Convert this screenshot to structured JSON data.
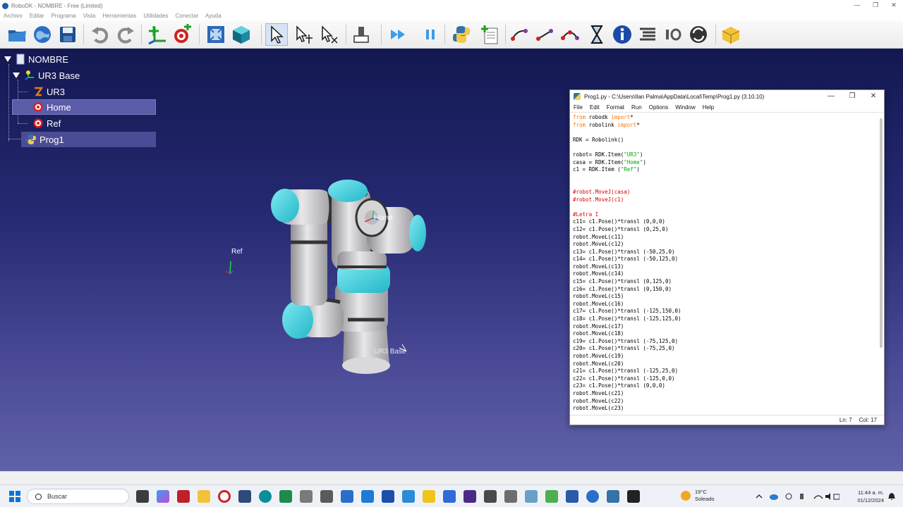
{
  "window": {
    "title": "RoboDK - NOMBRE - Free (Limited)",
    "controls": [
      "—",
      "❐",
      "✕"
    ]
  },
  "menu": [
    "Archivo",
    "Editar",
    "Programa",
    "Vista",
    "Herramientas",
    "Utilidades",
    "Conectar",
    "Ayuda"
  ],
  "toolbar": {
    "icons": [
      "open-station-icon",
      "online-library-icon",
      "save-icon",
      "undo-icon",
      "redo-icon",
      "add-reference-frame-icon",
      "add-target-icon",
      "fit-all-icon",
      "view-iso-icon",
      "select-icon",
      "move-reference-icon",
      "move-tool-icon",
      "move-robot-icon",
      "play-icon",
      "pause-icon",
      "python-icon",
      "add-program-icon",
      "movej-icon",
      "movel-icon",
      "movec-icon",
      "pause-instruction-icon",
      "info-icon",
      "program-list-icon",
      "io-icon",
      "program-call-icon",
      "package-icon"
    ]
  },
  "tree": {
    "station": "NOMBRE",
    "base": "UR3 Base",
    "robot": "UR3",
    "target1": "Home",
    "target2": "Ref",
    "program": "Prog1"
  },
  "scene": {
    "ref_label": "Ref",
    "home_label": "Home",
    "base_label": "UR3 Base",
    "robot_colors": {
      "joint_cap": "#47d6e2",
      "body": "#c9c9cb",
      "band": "#3a3a3a"
    }
  },
  "editor": {
    "title": "Prog1.py - C:\\Users\\Ilan Palma\\AppData\\Local\\Temp\\Prog1.py (3.10.10)",
    "menu": [
      "File",
      "Edit",
      "Format",
      "Run",
      "Options",
      "Window",
      "Help"
    ],
    "status_line": "Ln: 7",
    "status_col": "Col: 17",
    "code": [
      "from robodk import*",
      "from robolink import*",
      "",
      "RDK = Robolink()",
      "",
      "robot= RDK.Item(\"UR3\")",
      "casa = RDK.Item(\"Home\")",
      "c1 = RDK.Item (\"Ref\")",
      "",
      "",
      "#robot.MoveJ(casa)",
      "#robot.MoveJ(c1)",
      "",
      "#Letra I",
      "c11= c1.Pose()*transl (0,0,0)",
      "c12= c1.Pose()*transl (0,25,0)",
      "robot.MoveL(c11)",
      "robot.MoveL(c12)",
      "c13= c1.Pose()*transl (-50,25,0)",
      "c14= c1.Pose()*transl (-50,125,0)",
      "robot.MoveL(c13)",
      "robot.MoveL(c14)",
      "c15= c1.Pose()*transl (0,125,0)",
      "c16= c1.Pose()*transl (0,150,0)",
      "robot.MoveL(c15)",
      "robot.MoveL(c16)",
      "c17= c1.Pose()*transl (-125,150,0)",
      "c18= c1.Pose()*transl (-125,125,0)",
      "robot.MoveL(c17)",
      "robot.MoveL(c18)",
      "c19= c1.Pose()*transl (-75,125,0)",
      "c20= c1.Pose()*transl (-75,25,0)",
      "robot.MoveL(c19)",
      "robot.MoveL(c20)",
      "c21= c1.Pose()*transl (-125,25,0)",
      "c22= c1.Pose()*transl (-125,0,0)",
      "c23= c1.Pose()*transl (0,0,0)",
      "robot.MoveL(c21)",
      "robot.MoveL(c22)",
      "robot.MoveL(c23)"
    ]
  },
  "taskbar": {
    "search_placeholder": "Buscar",
    "weather_temp": "19°C",
    "weather_desc": "Soleado",
    "time": "11:44 a. m.",
    "date": "01/12/2024"
  }
}
